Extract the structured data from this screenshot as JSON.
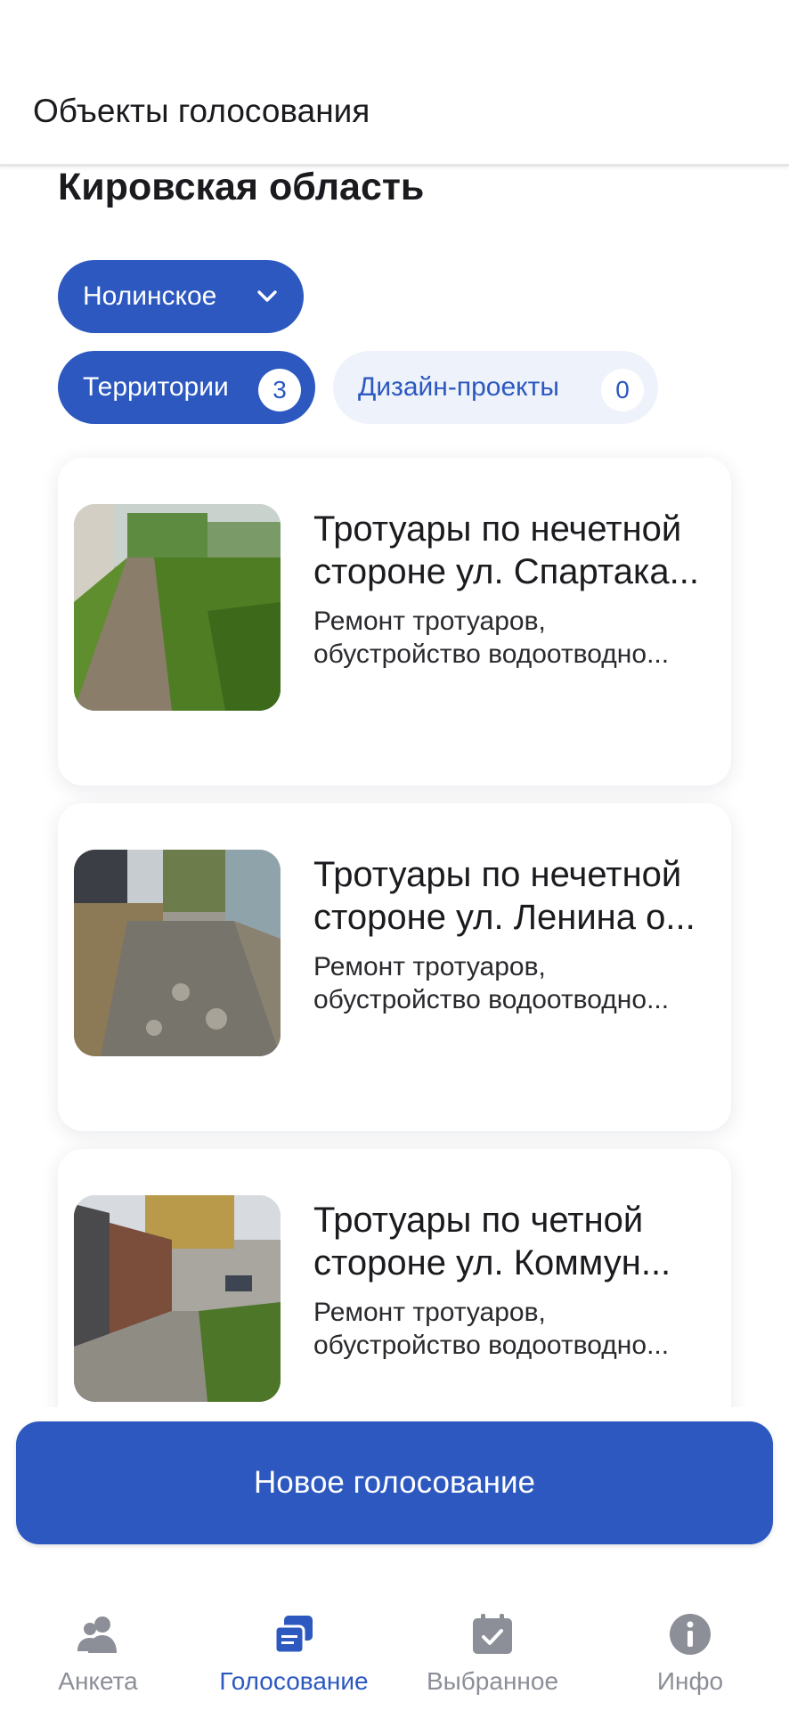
{
  "app_bar": {
    "title": "Объекты голосования"
  },
  "region": {
    "title": "Кировская область"
  },
  "municipality_select": {
    "value": "Нолинское"
  },
  "tabs": [
    {
      "label": "Территории",
      "count": "3",
      "active": true
    },
    {
      "label": "Дизайн-проекты",
      "count": "0",
      "active": false
    }
  ],
  "cards": [
    {
      "title_lines": [
        "Тротуары по нечетной",
        "стороне ул. Спартака..."
      ],
      "desc_lines": [
        "Ремонт тротуаров,",
        "обустройство водоотводно..."
      ],
      "image": "sidewalk-grass-photo"
    },
    {
      "title_lines": [
        "Тротуары по нечетной",
        "стороне ул. Ленина о..."
      ],
      "desc_lines": [
        "Ремонт тротуаров,",
        "обустройство водоотводно..."
      ],
      "image": "sidewalk-cobble-photo"
    },
    {
      "title_lines": [
        "Тротуары по четной",
        "стороне ул. Коммун..."
      ],
      "desc_lines": [
        "Ремонт тротуаров,",
        "обустройство водоотводно..."
      ],
      "image": "sidewalk-fence-photo"
    }
  ],
  "new_vote_button": {
    "label": "Новое голосование"
  },
  "bottom_nav": [
    {
      "label": "Анкета",
      "icon": "people-icon",
      "active": false
    },
    {
      "label": "Голосование",
      "icon": "ballot-icon",
      "active": true
    },
    {
      "label": "Выбранное",
      "icon": "calendar-check-icon",
      "active": false
    },
    {
      "label": "Инфо",
      "icon": "info-icon",
      "active": false
    }
  ],
  "colors": {
    "accent": "#2c58c0",
    "inactive_nav": "#8c8f97",
    "chip_inactive_bg": "#eef2fb"
  }
}
